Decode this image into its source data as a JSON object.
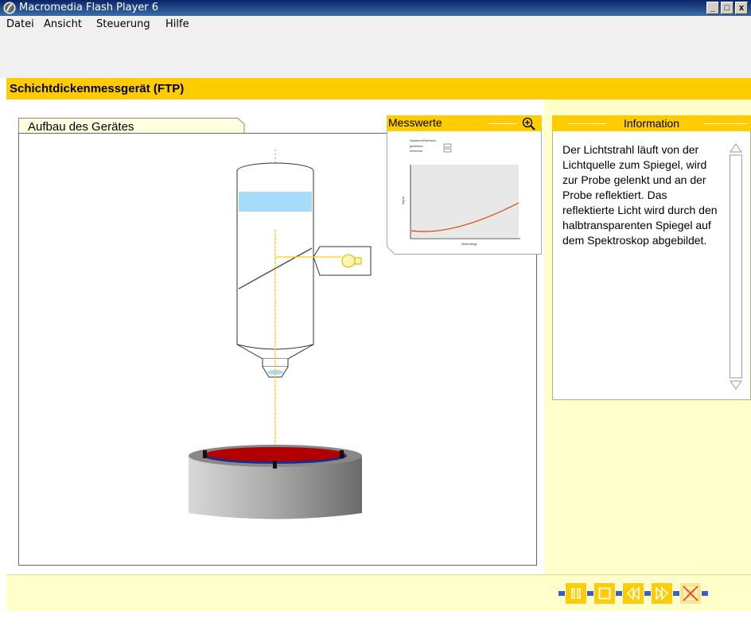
{
  "window": {
    "title": "Macromedia Flash Player 6",
    "buttons": [
      "_",
      "□",
      "x"
    ]
  },
  "menu": {
    "items": [
      "Datei",
      "Ansicht",
      "Steuerung",
      "Hilfe"
    ]
  },
  "header": {
    "title": "Schichtdickenmessgerät (FTP)"
  },
  "stage": {
    "tab_label": "Aufbau des Gerätes"
  },
  "messwerte": {
    "title": "Messwerte",
    "thumbnail_legend_title": "Spektren/Referenz",
    "thumbnail_legend_1": "gemessen",
    "thumbnail_legend_2": "berechnet",
    "thumbnail_xlabel": "Wellenlänge",
    "thumbnail_ylabel": "Signal"
  },
  "info": {
    "title": "Information",
    "text": "Der Lichtstrahl läuft von der Lichtquelle zum Spiegel, wird zur Probe gelenkt und an der Probe reflektiert. Das reflektierte Licht wird durch den halbtransparenten Spiegel auf dem Spektroskop abgebildet."
  },
  "controls": {
    "items": [
      "pause",
      "stop",
      "rewind",
      "forward",
      "close"
    ]
  },
  "colors": {
    "titlebar": "#0a246a",
    "accent": "#ffcc00",
    "panel": "#ffffcc",
    "sample": "#b00000",
    "beam": "#ffd000"
  }
}
